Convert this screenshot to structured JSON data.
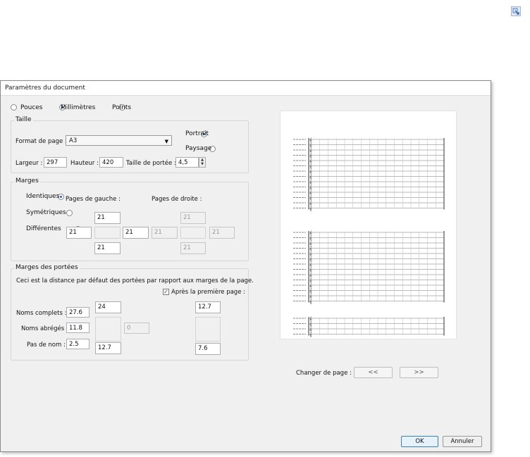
{
  "dialog": {
    "title": "Paramètres du document",
    "units": {
      "pouces": "Pouces",
      "millimetres": "Millimètres",
      "points": "Points",
      "selected": "Millimètres"
    }
  },
  "taille": {
    "legend": "Taille",
    "format_label": "Format de page :",
    "format_value": "A3",
    "portrait": "Portrait",
    "paysage": "Paysage",
    "orientation_selected": "Portrait",
    "largeur_label": "Largeur :",
    "largeur_value": "297",
    "hauteur_label": "Hauteur :",
    "hauteur_value": "420",
    "portee_label": "Taille de portée :",
    "portee_value": "4,5"
  },
  "marges": {
    "legend": "Marges",
    "identiques": "Identiques",
    "symetriques": "Symétriques",
    "differentes": "Différentes",
    "selected": "Identiques",
    "gauche_label": "Pages de gauche :",
    "droite_label": "Pages de droite :",
    "gauche_top": "21",
    "gauche_left": "21",
    "gauche_right": "21",
    "gauche_bottom": "21",
    "droite_top": "21",
    "droite_left": "21",
    "droite_right": "21",
    "droite_bottom": "21"
  },
  "marges_portees": {
    "legend": "Marges des portées",
    "description": "Ceci est la distance par défaut des portées par rapport aux marges de la page.",
    "apres_label": "Après la première page :",
    "apres_checked": true,
    "noms_complets_label": "Noms complets :",
    "noms_complets_value": "27.6",
    "noms_abreges_label": "Noms abrégés :",
    "noms_abreges_value": "11.8",
    "pas_de_nom_label": "Pas de nom :",
    "pas_de_nom_value": "2.5",
    "top_value": "24",
    "bottom_value": "12.7",
    "disabled_value": "0",
    "right_top_value": "12.7",
    "right_bottom_value": "7.6"
  },
  "preview": {
    "change_page_label": "Changer de page :",
    "prev_label": "<<",
    "next_label": ">>"
  },
  "buttons": {
    "ok": "OK",
    "annuler": "Annuler"
  },
  "colors": {
    "selected_radio": "#2a5ea8",
    "ok_border": "#3c7fb1",
    "dialog_bg": "#f0f0f0"
  },
  "icons": {
    "corner": "resize-corner-icon"
  }
}
